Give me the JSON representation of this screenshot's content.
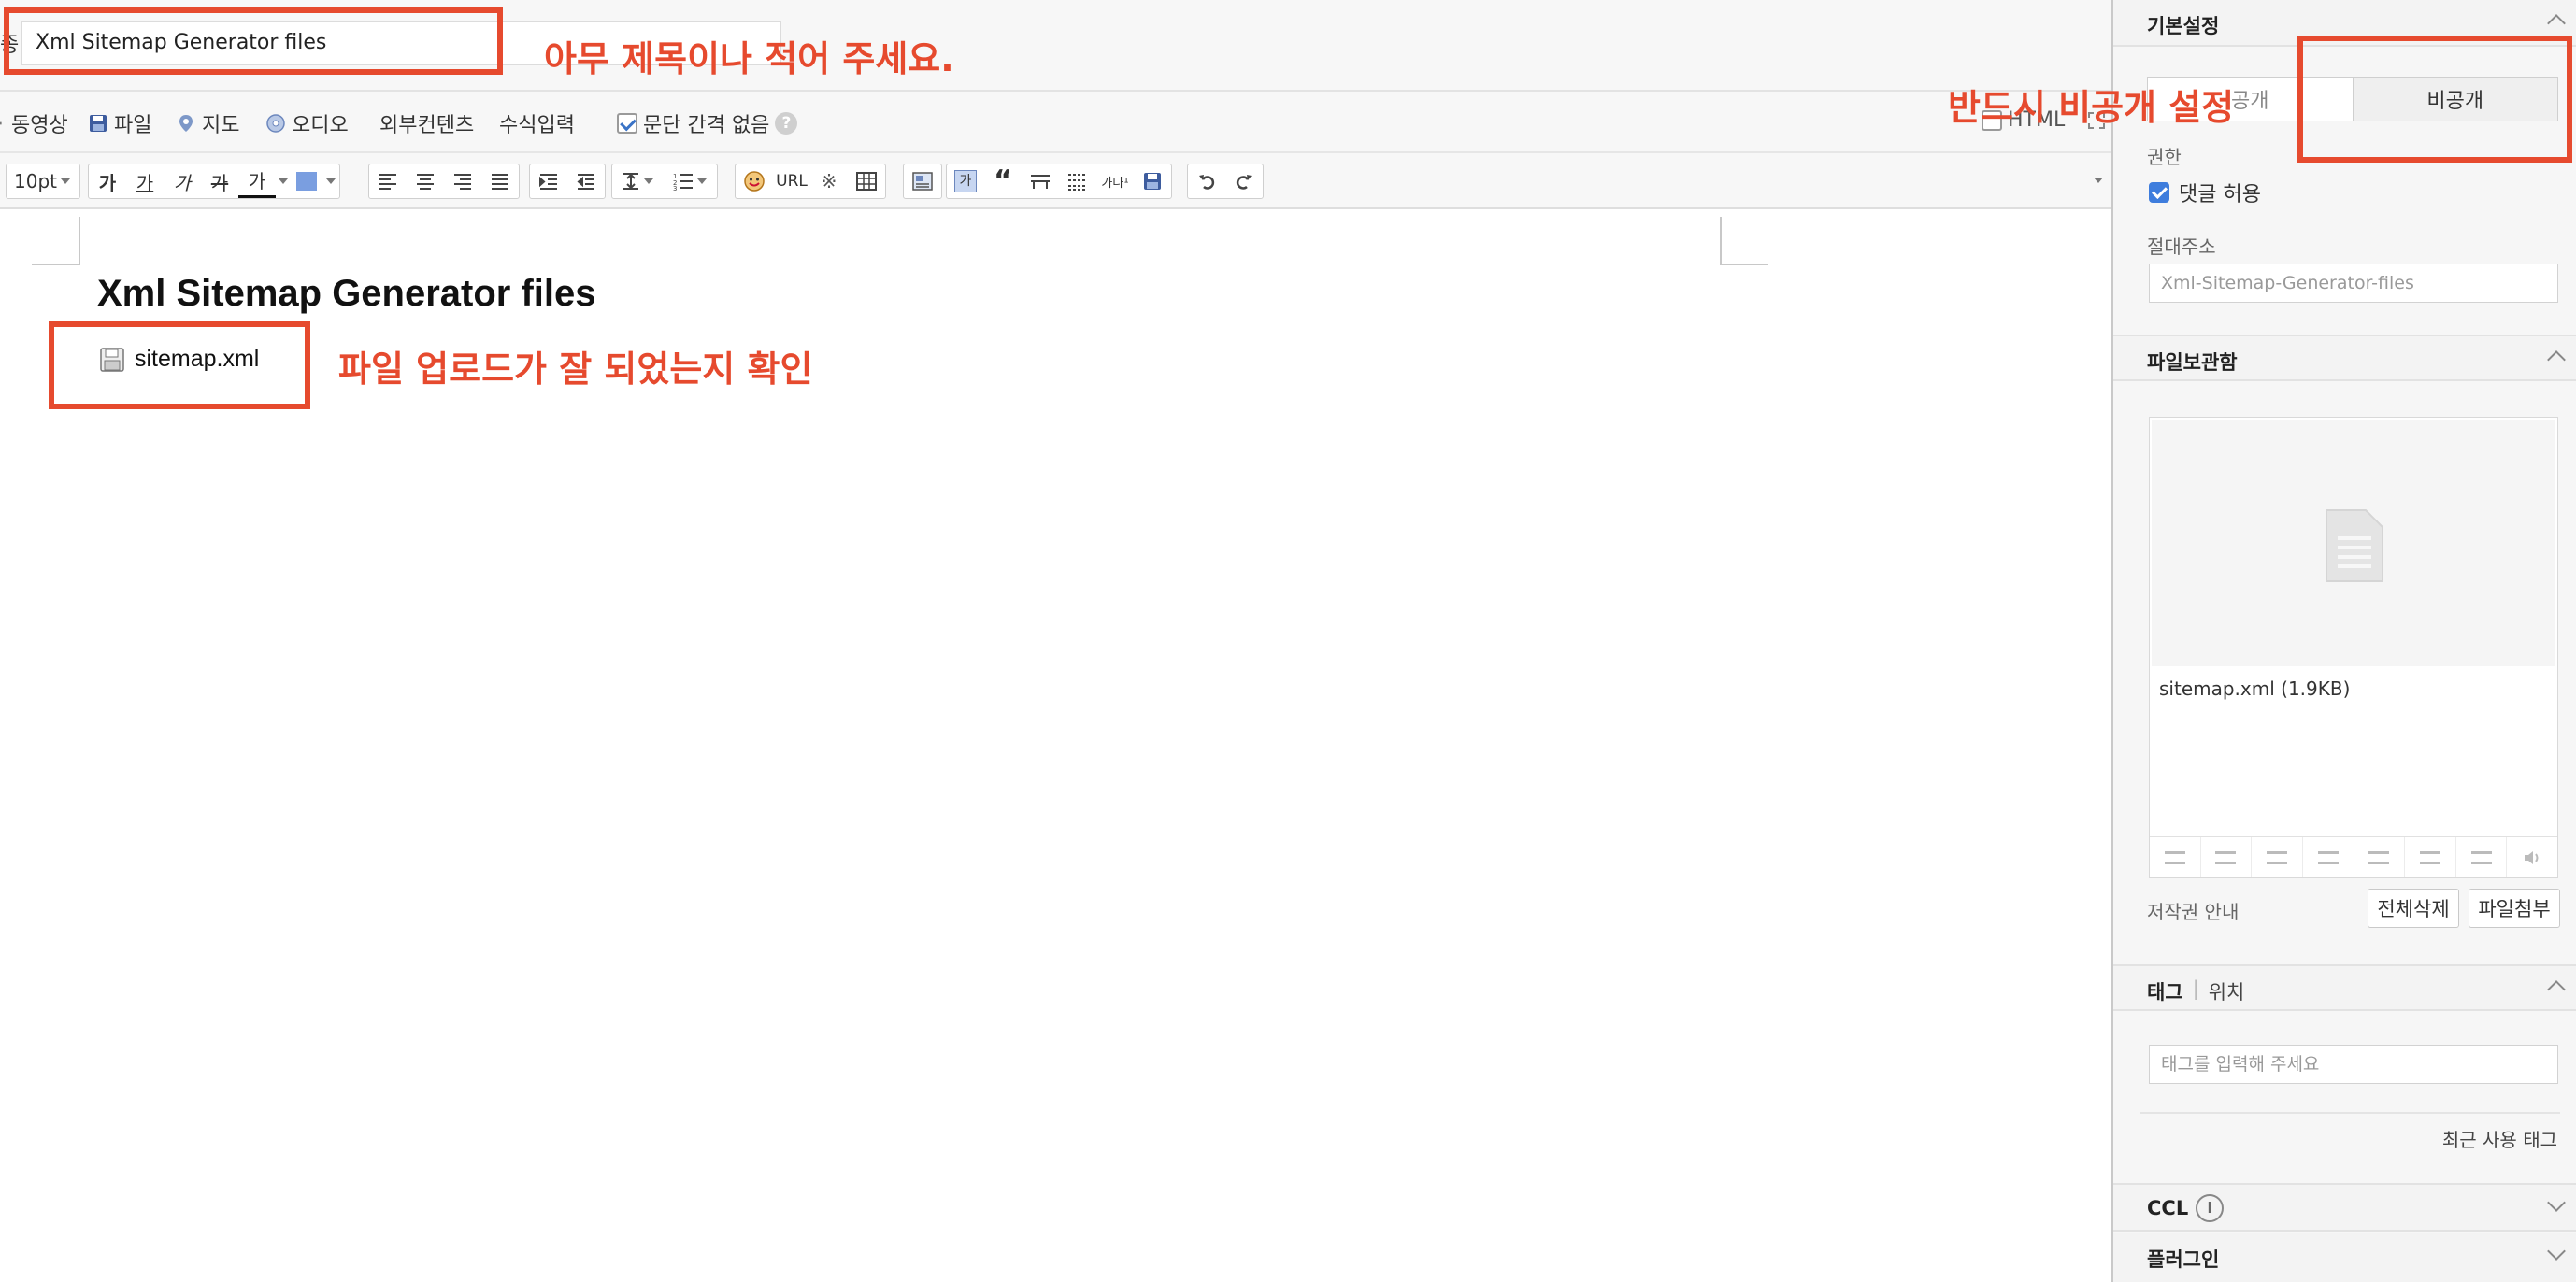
{
  "title_bar": {
    "left_glyph": "종",
    "title_value": "Xml Sitemap Generator files"
  },
  "toolbar1": {
    "items": [
      "동영상",
      "파일",
      "지도",
      "오디오",
      "외부컨텐츠",
      "수식입력"
    ],
    "paragraph_spacing_label": "문단 간격 없음",
    "html_label": "HTML"
  },
  "toolbar2": {
    "font_size": "10pt",
    "text_style_glyphs": [
      "가",
      "가",
      "가",
      "가",
      "가"
    ],
    "url_label": "URL"
  },
  "editor": {
    "heading": "Xml Sitemap Generator files",
    "attachment": "sitemap.xml"
  },
  "annotations": {
    "title_hint": "아무 제목이나 적어 주세요.",
    "upload_hint": "파일 업로드가 잘 되었는지 확인",
    "private_hint": "반드시 비공개 설정"
  },
  "panel": {
    "basic_settings": {
      "title": "기본설정",
      "visibility_public": "공개",
      "visibility_private": "비공개",
      "permission_label": "권한",
      "allow_comments": "댓글 허용",
      "permalink_label": "절대주소",
      "permalink_value": "Xml-Sitemap-Generator-files"
    },
    "file_storage": {
      "title": "파일보관함",
      "file_entry": "sitemap.xml (1.9KB)",
      "copyright_label": "저작권 안내",
      "delete_all": "전체삭제",
      "attach_file": "파일첨부"
    },
    "tags": {
      "title": "태그",
      "separator": "|",
      "location_tab": "위치",
      "placeholder": "태그를 입력해 주세요",
      "recent_tags": "최근 사용 태그"
    },
    "ccl": {
      "title": "CCL"
    },
    "plugin": {
      "title": "플러그인"
    }
  },
  "colors": {
    "annotation_red": "#e64a2e",
    "checkbox_blue": "#3e7ddd"
  }
}
